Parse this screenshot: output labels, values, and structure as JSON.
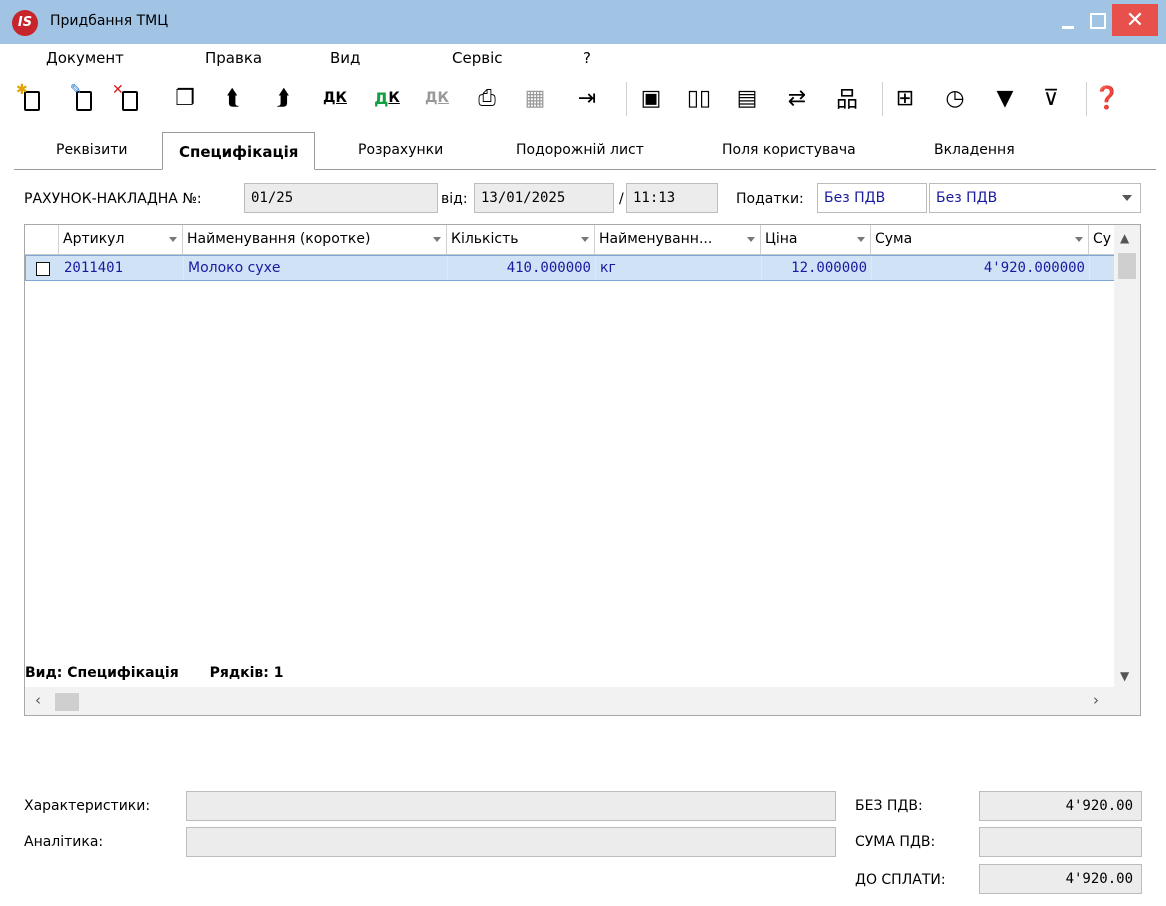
{
  "window": {
    "title": "Придбання ТМЦ",
    "logo_text": "IS"
  },
  "menu": [
    "Документ",
    "Правка",
    "Вид",
    "Сервіс",
    "?"
  ],
  "toolbar": {
    "icons": [
      "new-icon",
      "edit-icon",
      "delete-icon",
      "copy-icon",
      "up-icon",
      "upload-icon",
      "dk-post-icon",
      "dk-post-green-icon",
      "dk-gray-icon",
      "print-icon",
      "excel-icon",
      "exit-icon",
      "save-icon",
      "book-icon",
      "folder-icon",
      "transfer-icon",
      "tree-icon",
      "table-icon",
      "history-icon",
      "filter-icon",
      "clear-filter-icon",
      "help-icon"
    ]
  },
  "tabs": [
    "Реквізити",
    "Специфікація",
    "Розрахунки",
    "Подорожній лист",
    "Поля користувача",
    "Вкладення"
  ],
  "active_tab": "Специфікація",
  "header": {
    "invoice_label": "РАХУНОК-НАКЛАДНА №:",
    "invoice_number": "01/25",
    "date_label": "від:",
    "date": "13/01/2025",
    "time_sep": "/",
    "time": "11:13",
    "taxes_label": "Податки:",
    "tax_value_1": "Без ПДВ",
    "tax_value_2": "Без ПДВ"
  },
  "grid": {
    "columns": [
      "Артикул",
      "Найменування (коротке)",
      "Кількість",
      "Найменуванн...",
      "Ціна",
      "Сума",
      "Су"
    ],
    "rows": [
      {
        "article": "2011401",
        "name": "Молоко сухе",
        "qty": "410.000000",
        "unit": "кг",
        "price": "12.000000",
        "sum": "4'920.000000"
      }
    ],
    "status_view": "Вид: Специфікація",
    "status_rows": "Рядків: 1"
  },
  "footer": {
    "characteristics_label": "Характеристики:",
    "analytics_label": "Аналітика:",
    "no_vat_label": "БЕЗ ПДВ:",
    "no_vat_value": "4'920.00",
    "vat_label": "СУМА ПДВ:",
    "vat_value": "",
    "to_pay_label": "ДО СПЛАТИ:",
    "to_pay_value": "4'920.00"
  },
  "colors": {
    "titlebar": "#a1c4e5",
    "close": "#e8504c",
    "row_selected": "#cfe2f6",
    "value_text": "#1a1aa0"
  }
}
